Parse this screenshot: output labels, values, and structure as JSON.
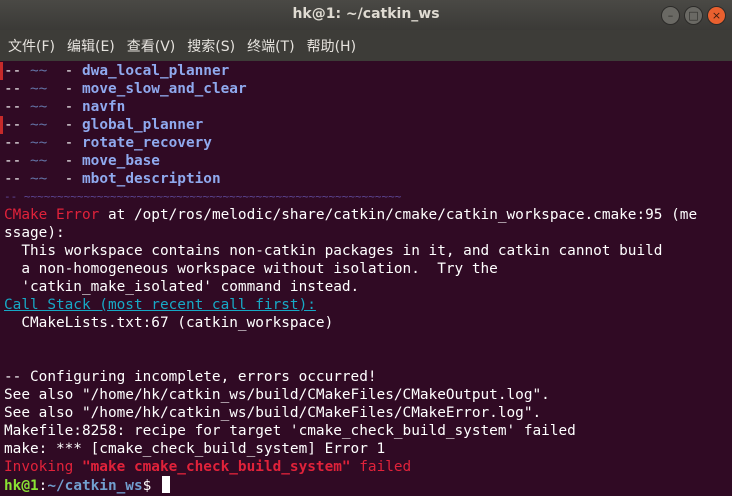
{
  "window": {
    "title": "hk@1: ~/catkin_ws",
    "buttons": {
      "minimize": "–",
      "maximize": "□",
      "close": "×"
    }
  },
  "menu": {
    "items": [
      "文件(F)",
      "编辑(E)",
      "查看(V)",
      "搜索(S)",
      "终端(T)",
      "帮助(H)"
    ]
  },
  "terminal": {
    "package_prefix_dash": "--",
    "package_prefix_tilde": "~~",
    "package_prefix_bullet": "  -",
    "packages": [
      "dwa_local_planner",
      "move_slow_and_clear",
      "navfn",
      "global_planner",
      "rotate_recovery",
      "move_base",
      "mbot_description"
    ],
    "separator": "-- ~~~~~~~~~~~~~~~~~~~~~~~~~~~~~~~~~~~~~~~~~~~~~~~~~~~~~~~~~",
    "cmake_error_label": "CMake Error",
    "cmake_error_at": " at /opt/ros/melodic/share/catkin/cmake/catkin_workspace.cmake:95 (me",
    "cmake_error_cont": "ssage):",
    "message": [
      "  This workspace contains non-catkin packages in it, and catkin cannot build",
      "  a non-homogeneous workspace without isolation.  Try the",
      "  'catkin_make_isolated' command instead."
    ],
    "call_stack": "Call Stack (most recent call first):",
    "call_stack_entry": "  CMakeLists.txt:67 (catkin_workspace)",
    "configuring": "-- Configuring incomplete, errors occurred!",
    "see_also_1": "See also \"/home/hk/catkin_ws/build/CMakeFiles/CMakeOutput.log\".",
    "see_also_2": "See also \"/home/hk/catkin_ws/build/CMakeFiles/CMakeError.log\".",
    "makefile_line": "Makefile:8258: recipe for target 'cmake_check_build_system' failed",
    "make_error": "make: *** [cmake_check_build_system] Error 1",
    "invoking_1": "Invoking ",
    "invoking_2": "\"make cmake_check_build_system\"",
    "invoking_3": " failed",
    "prompt_user": "hk@1",
    "prompt_colon": ":",
    "prompt_path": "~/catkin_ws",
    "prompt_symbol": "$ "
  }
}
